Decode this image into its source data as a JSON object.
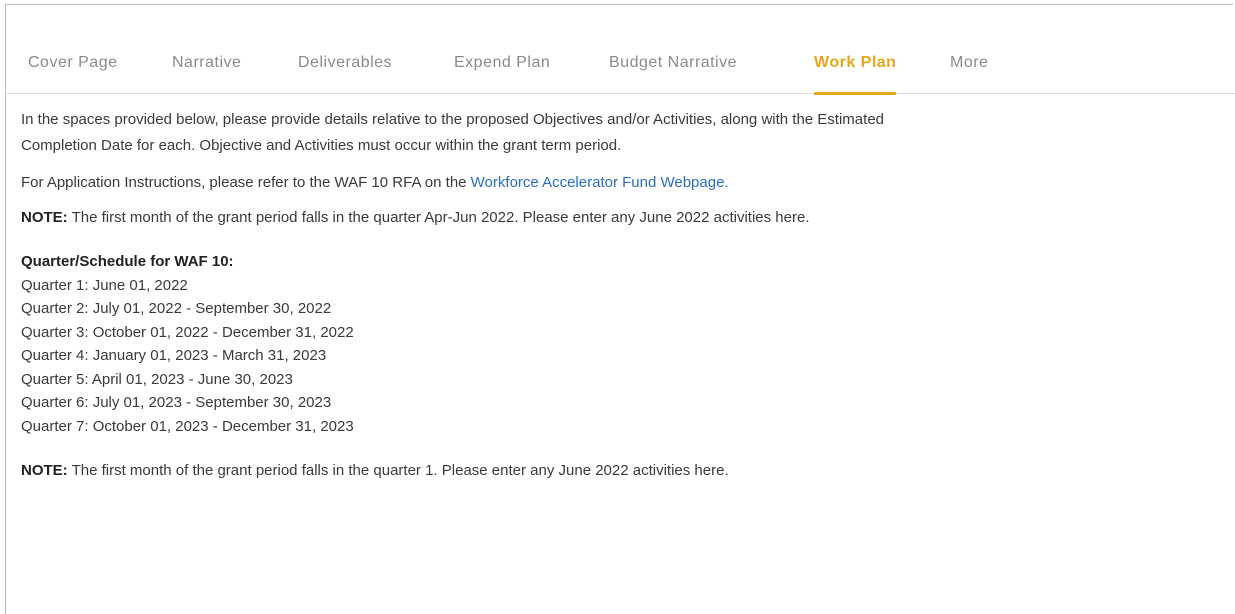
{
  "tabs": [
    {
      "label": "Cover Page"
    },
    {
      "label": "Narrative"
    },
    {
      "label": "Deliverables"
    },
    {
      "label": "Expend Plan"
    },
    {
      "label": "Budget Narrative"
    },
    {
      "label": "Work Plan",
      "active": true
    },
    {
      "label": "More"
    }
  ],
  "content": {
    "intro_line1": "In the spaces provided below, please provide details relative to the proposed Objectives and/or Activities, along with the Estimated",
    "intro_line2": "Completion Date for each. Objective and Activities must occur within the grant term period.",
    "instructions_prefix": "For Application Instructions, please refer to the WAF 10 RFA on the ",
    "instructions_link": "Workforce Accelerator Fund Webpage.",
    "note1_label": "NOTE:",
    "note1_text": " The first month of the grant period falls in the quarter Apr-Jun 2022. Please enter any June 2022 activities here.",
    "schedule_heading": "Quarter/Schedule for WAF 10:",
    "schedule": [
      "Quarter 1: June 01, 2022",
      "Quarter 2: July 01, 2022 - September 30, 2022",
      "Quarter 3: October 01, 2022 - December 31, 2022",
      "Quarter 4: January 01, 2023 - March 31, 2023",
      "Quarter 5: April 01, 2023 - June 30, 2023",
      "Quarter 6: July 01, 2023 - September 30, 2023",
      "Quarter 7: October 01, 2023 - December 31, 2023"
    ],
    "note2_label": "NOTE:",
    "note2_text": " The first month of the grant period falls in the quarter 1. Please enter any June 2022 activities here."
  },
  "colors": {
    "active_tab": "#e8a61c",
    "inactive_tab": "#8a8a8a",
    "link": "#2a6fb8"
  }
}
